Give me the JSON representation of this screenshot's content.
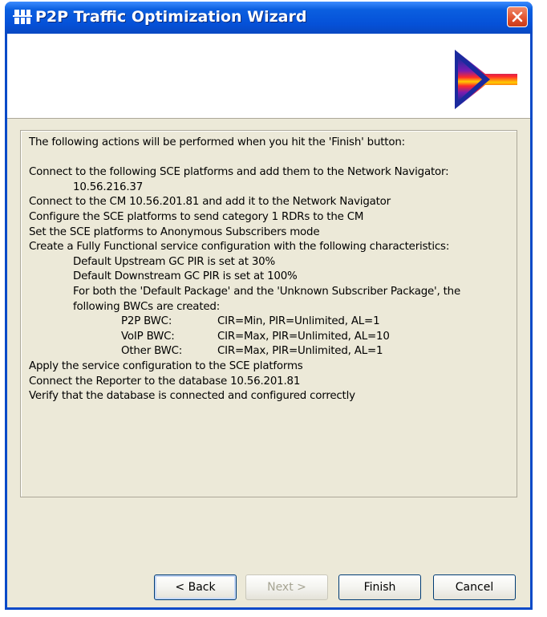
{
  "window": {
    "title": "P2P Traffic Optimization Wizard",
    "title_icon": "wizard-icon",
    "close_icon": "close-icon",
    "accent_color": "#0551d8"
  },
  "banner": {
    "graphic": "wizard-banner-graphic"
  },
  "summary": {
    "lines": [
      "The following actions will be performed when you hit the 'Finish' button:",
      "",
      "Connect to the following SCE platforms and add them to the Network Navigator:",
      "10.56.216.37",
      "Connect to the CM 10.56.201.81 and add it to the Network Navigator",
      "Configure the SCE platforms to send category 1 RDRs to the CM",
      "Set the SCE platforms to Anonymous Subscribers mode",
      "Create a Fully Functional service configuration with the following characteristics:",
      "Default Upstream GC PIR is set at 30%",
      "Default Downstream GC PIR is set at 100%",
      "For both the 'Default Package' and the 'Unknown Subscriber Package', the",
      "following BWCs are created:"
    ],
    "bwcs": [
      {
        "name": "P2P BWC:",
        "value": "CIR=Min, PIR=Unlimited, AL=1"
      },
      {
        "name": "VoIP BWC:",
        "value": "CIR=Max, PIR=Unlimited, AL=10"
      },
      {
        "name": "Other BWC:",
        "value": "CIR=Max, PIR=Unlimited, AL=1"
      }
    ],
    "after": [
      "Apply the service configuration to the SCE platforms",
      "Connect the Reporter to the database 10.56.201.81",
      "Verify that the database is connected and configured correctly"
    ]
  },
  "buttons": {
    "back": "< Back",
    "next": "Next >",
    "finish": "Finish",
    "cancel": "Cancel"
  },
  "side_id": "241967"
}
